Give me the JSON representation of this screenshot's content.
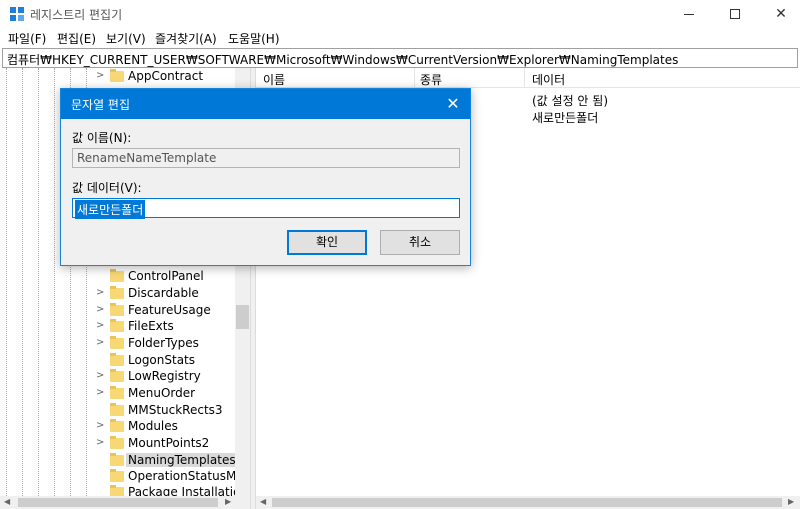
{
  "window": {
    "title": "레지스트리 편집기",
    "icon": "registry-editor-icon"
  },
  "menu": {
    "items": [
      "파일(F)",
      "편집(E)",
      "보기(V)",
      "즐겨찾기(A)",
      "도움말(H)"
    ]
  },
  "address": {
    "path": "컴퓨터₩HKEY_CURRENT_USER₩SOFTWARE₩Microsoft₩Windows₩CurrentVersion₩Explorer₩NamingTemplates"
  },
  "tree": {
    "items": [
      {
        "label": "AppContract",
        "chevron": ">"
      },
      {
        "label": "ControlPanel",
        "chevron": ""
      },
      {
        "label": "Discardable",
        "chevron": ">"
      },
      {
        "label": "FeatureUsage",
        "chevron": ">"
      },
      {
        "label": "FileExts",
        "chevron": ">"
      },
      {
        "label": "FolderTypes",
        "chevron": ">"
      },
      {
        "label": "LogonStats",
        "chevron": ""
      },
      {
        "label": "LowRegistry",
        "chevron": ">"
      },
      {
        "label": "MenuOrder",
        "chevron": ">"
      },
      {
        "label": "MMStuckRects3",
        "chevron": ""
      },
      {
        "label": "Modules",
        "chevron": ">"
      },
      {
        "label": "MountPoints2",
        "chevron": ">"
      },
      {
        "label": "NamingTemplates",
        "chevron": "",
        "selected": true
      },
      {
        "label": "OperationStatusMana",
        "chevron": ""
      },
      {
        "label": "Package Installation",
        "chevron": ""
      }
    ]
  },
  "list": {
    "columns": [
      "이름",
      "종류",
      "데이터"
    ],
    "rows": [
      {
        "data": "(값 설정 안 됨)"
      },
      {
        "data": "새로만든폴더"
      }
    ]
  },
  "dialog": {
    "title": "문자열 편집",
    "value_name_label": "값 이름(N):",
    "value_name": "RenameNameTemplate",
    "value_data_label": "값 데이터(V):",
    "value_data": "새로만든폴더",
    "ok_label": "확인",
    "cancel_label": "취소"
  },
  "colors": {
    "accent": "#0078d7",
    "folder": "#f8d775"
  }
}
